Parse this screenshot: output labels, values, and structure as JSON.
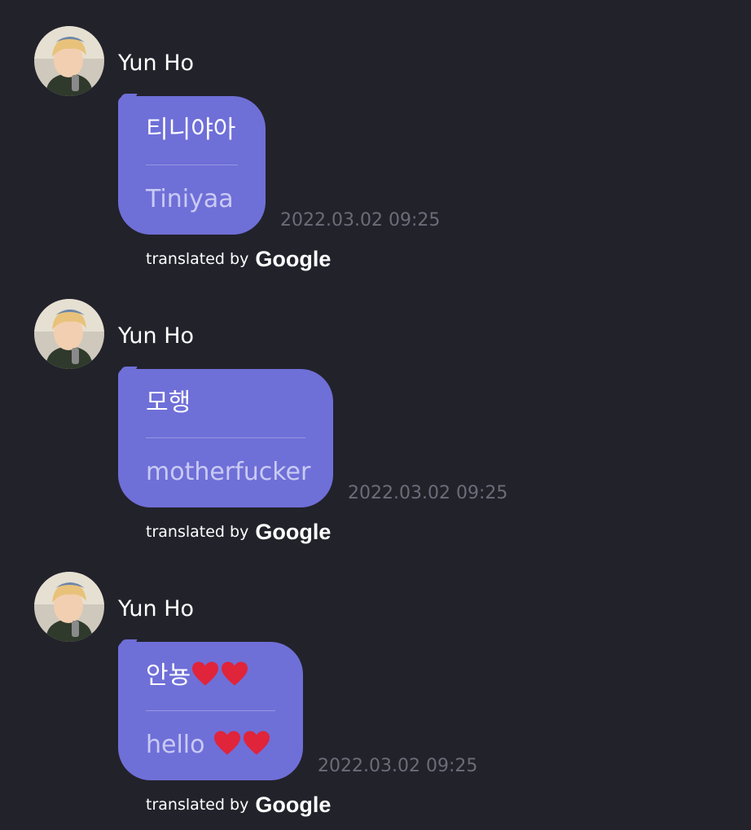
{
  "conversation": {
    "messages": [
      {
        "sender": "Yun Ho",
        "original": "티니야아",
        "translation": "Tiniyaa",
        "timestamp": "2022.03.02 09:25",
        "credit_text": "translated by",
        "credit_brand": "Google"
      },
      {
        "sender": "Yun Ho",
        "original": "모행",
        "translation": "motherfucker",
        "timestamp": "2022.03.02 09:25",
        "credit_text": "translated by",
        "credit_brand": "Google"
      },
      {
        "sender": "Yun Ho",
        "original": "안뇽",
        "translation": "hello",
        "timestamp": "2022.03.02 09:25",
        "credit_text": "translated by",
        "credit_brand": "Google",
        "heart_icons": [
          "heart-icon",
          "heart-icon"
        ]
      }
    ]
  },
  "colors": {
    "background": "#22222b",
    "bubble": "#6f6fd8",
    "translation_text": "#c9caf4",
    "timestamp": "#6b6c78",
    "heart": "#e0243a"
  }
}
